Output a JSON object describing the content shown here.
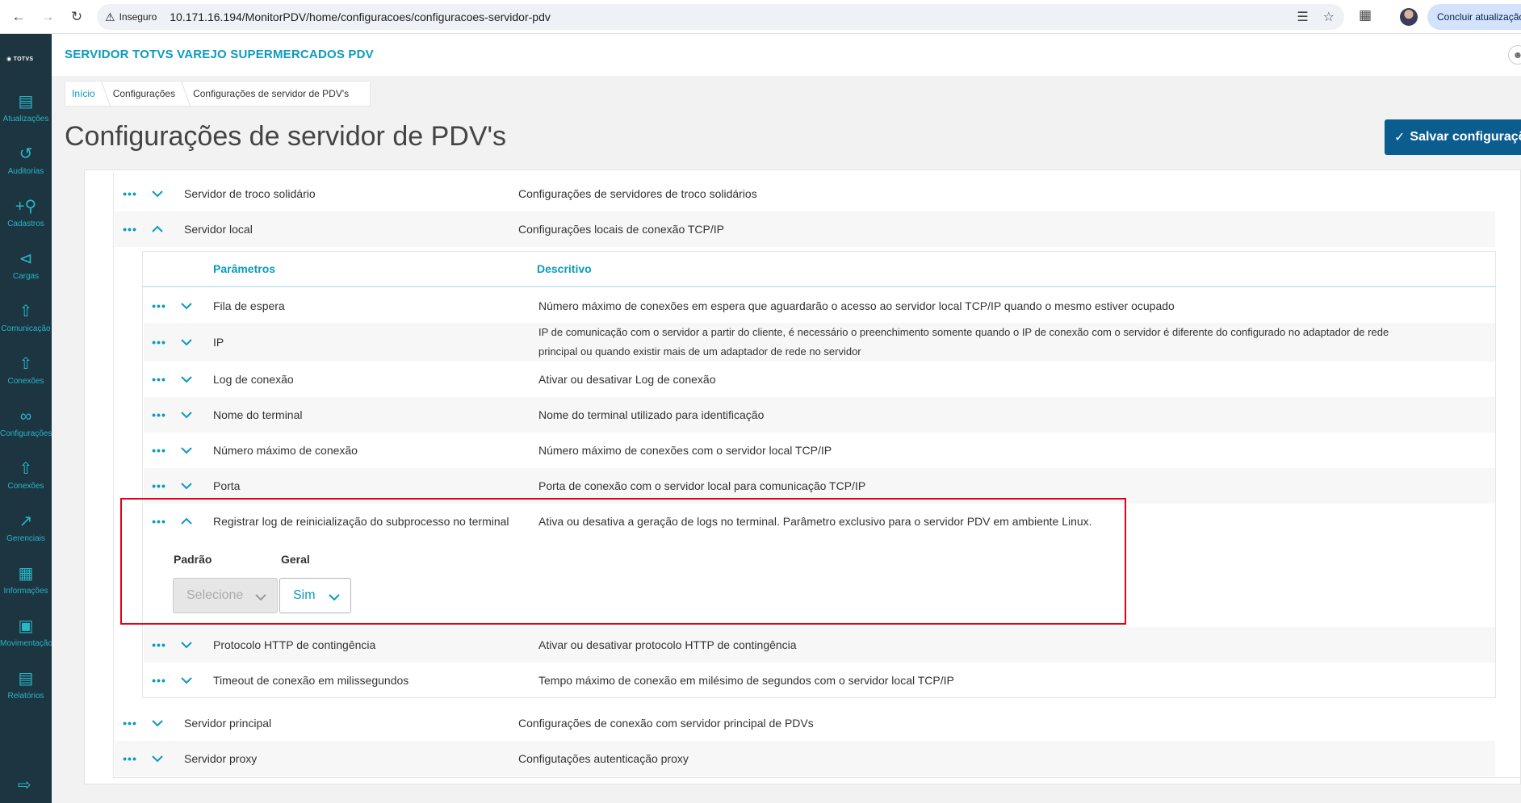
{
  "browser": {
    "security_label": "Inseguro",
    "url": "10.171.16.194/MonitorPDV/home/configuracoes/configuracoes-servidor-pdv",
    "update_button": "Concluir atualização"
  },
  "sidebar": {
    "logo": "TOTVS",
    "items": [
      {
        "label": "Atualizações",
        "icon": "server-icon"
      },
      {
        "label": "Auditorias",
        "icon": "history-icon"
      },
      {
        "label": "Cadastros",
        "icon": "add-user-icon"
      },
      {
        "label": "Cargas",
        "icon": "share-icon"
      },
      {
        "label": "Comunicação",
        "icon": "upload-doc-icon"
      },
      {
        "label": "Conexões",
        "icon": "upload-doc-icon"
      },
      {
        "label": "Configurações",
        "icon": "link-icon"
      },
      {
        "label": "Conexões",
        "icon": "upload-doc-icon"
      },
      {
        "label": "Gerenciais",
        "icon": "chart-icon"
      },
      {
        "label": "Informações",
        "icon": "building-icon"
      },
      {
        "label": "Movimentação",
        "icon": "book-icon"
      },
      {
        "label": "Relatórios",
        "icon": "document-icon"
      }
    ]
  },
  "header": {
    "app_title": "SERVIDOR TOTVS VAREJO SUPERMERCADOS PDV"
  },
  "breadcrumb": [
    "Início",
    "Configurações",
    "Configurações de servidor de PDV's"
  ],
  "page": {
    "title": "Configurações de servidor de PDV's",
    "save_button": "Salvar configurações"
  },
  "groups_top": [
    {
      "name": "Servidor de troco solidário",
      "description": "Configurações de servidores de troco solidários"
    },
    {
      "name": "Servidor local",
      "description": "Configurações locais de conexão TCP/IP"
    }
  ],
  "param_table": {
    "col_params": "Parâmetros",
    "col_desc": "Descritivo",
    "rows": [
      {
        "name": "Fila de espera",
        "description": "Número máximo de conexões em espera que aguardarão o acesso ao servidor local TCP/IP quando o mesmo estiver ocupado"
      },
      {
        "name": "IP",
        "description_line1": "IP de comunicação com o servidor a partir do cliente, é necessário o preenchimento somente quando o IP de conexão com o servidor é diferente do configurado no adaptador de rede",
        "description_line2": "principal ou quando existir mais de um adaptador de rede no servidor"
      },
      {
        "name": "Log de conexão",
        "description": "Ativar ou desativar Log de conexão"
      },
      {
        "name": "Nome do terminal",
        "description": "Nome do terminal utilizado para identificação"
      },
      {
        "name": "Número máximo de conexão",
        "description": "Número máximo de conexões com o servidor local TCP/IP"
      },
      {
        "name": "Porta",
        "description": "Porta de conexão com o servidor local para comunicação TCP/IP"
      },
      {
        "name": "Registrar log de reinicialização do subprocesso no terminal",
        "description": "Ativa ou desativa a geração de logs no terminal. Parâmetro exclusivo para o servidor PDV em ambiente Linux."
      },
      {
        "name": "Protocolo HTTP de contingência",
        "description": "Ativar ou desativar protocolo HTTP de contingência"
      },
      {
        "name": "Timeout de conexão em milissegundos",
        "description": "Tempo máximo de conexão em milésimo de segundos com o servidor local TCP/IP"
      }
    ],
    "expanded": {
      "default_label": "Padrão",
      "default_value": "Selecione",
      "general_label": "Geral",
      "general_value": "Sim"
    }
  },
  "groups_bottom": [
    {
      "name": "Servidor principal",
      "description": "Configurações de conexão com servidor principal de PDVs"
    },
    {
      "name": "Servidor proxy",
      "description": "Configutações autenticação proxy"
    }
  ],
  "colors": {
    "accent": "#0c9abe",
    "sidebar_bg": "#1d3441",
    "save_button_bg": "#0c5d8f",
    "highlight_border": "#e1001a"
  }
}
